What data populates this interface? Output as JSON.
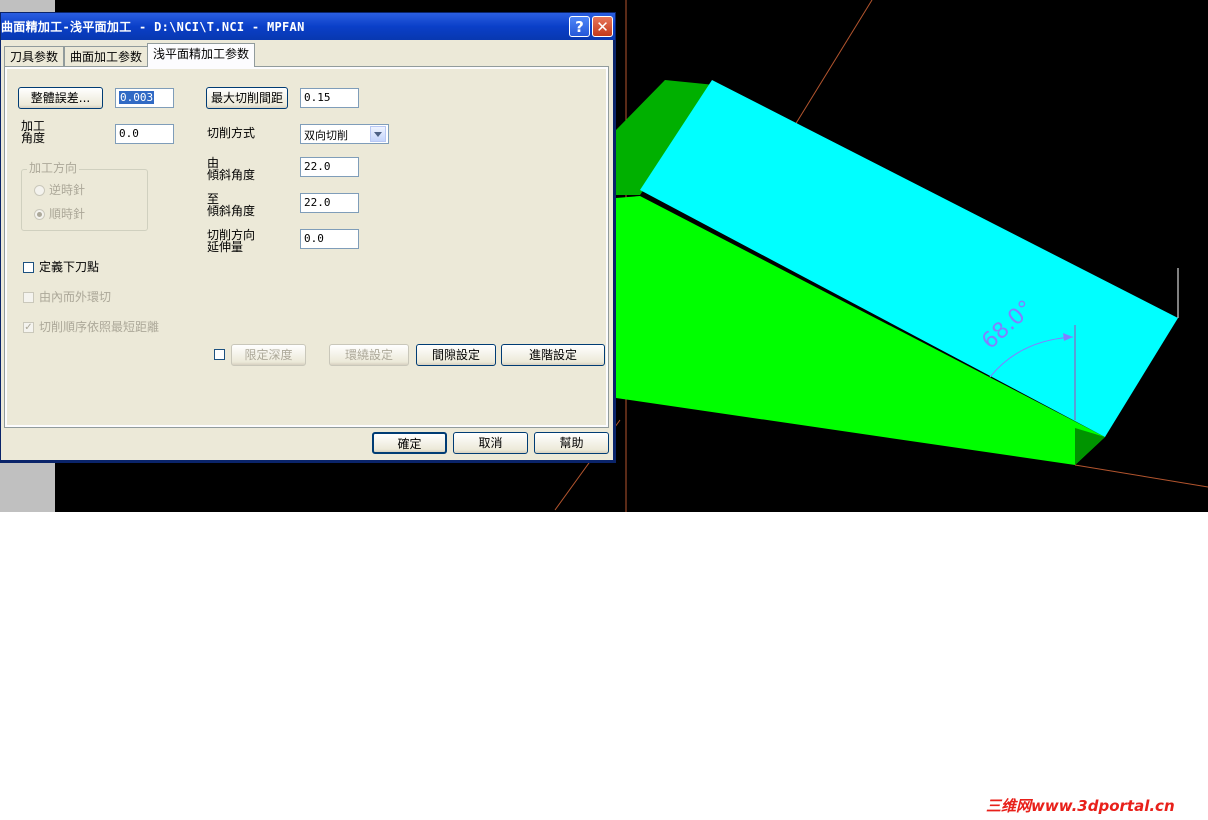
{
  "window": {
    "title": "曲面精加工-浅平面加工 - D:\\NCI\\T.NCI - MPFAN",
    "help_glyph": "?",
    "close_glyph": "✕"
  },
  "tabs": [
    {
      "label": "刀具参数"
    },
    {
      "label": "曲面加工参数"
    },
    {
      "label": "浅平面精加工参数"
    }
  ],
  "params": {
    "total_tolerance_button": "整體誤差...",
    "total_tolerance_value": "0.003",
    "max_stepover_button": "最大切削間距",
    "max_stepover_value": "0.15",
    "machining_angle_label_1": "加工",
    "machining_angle_label_2": "角度",
    "machining_angle_value": "0.0",
    "cut_method_label": "切削方式",
    "cut_method_value": "双向切削",
    "from_label_1": "由",
    "from_label_2": "傾斜角度",
    "from_value": "22.0",
    "to_label_1": "至",
    "to_label_2": "傾斜角度",
    "to_value": "22.0",
    "extension_label_1": "切削方向",
    "extension_label_2": "延伸量",
    "extension_value": "0.0"
  },
  "direction_group": {
    "title": "加工方向",
    "options": [
      {
        "label": "逆時針",
        "selected": false
      },
      {
        "label": "順時針",
        "selected": true
      }
    ]
  },
  "checkboxes": {
    "define_plunge": {
      "label": "定義下刀點",
      "checked": false,
      "enabled": true
    },
    "inside_out": {
      "label": "由內而外環切",
      "checked": false,
      "enabled": false
    },
    "shortest_distance": {
      "label": "切削順序依照最短距離",
      "checked": true,
      "enabled": false
    },
    "limit_depth": {
      "label": "限定深度",
      "checked": false,
      "enabled": false
    }
  },
  "buttons": {
    "limit_depth": "限定深度",
    "wrap_settings": "環繞設定",
    "gap_settings": "間隙設定",
    "advanced_settings": "進階設定",
    "ok": "確定",
    "cancel": "取消",
    "help": "幫助"
  },
  "viewport": {
    "angle_label": "68.0°",
    "colors": {
      "top_face": "#00ffff",
      "side_face": "#00ff00",
      "dark_face": "#00b000",
      "axis": "#b3552e",
      "dimension": "#8080ff"
    }
  },
  "watermark": "三维网www.3dportal.cn"
}
